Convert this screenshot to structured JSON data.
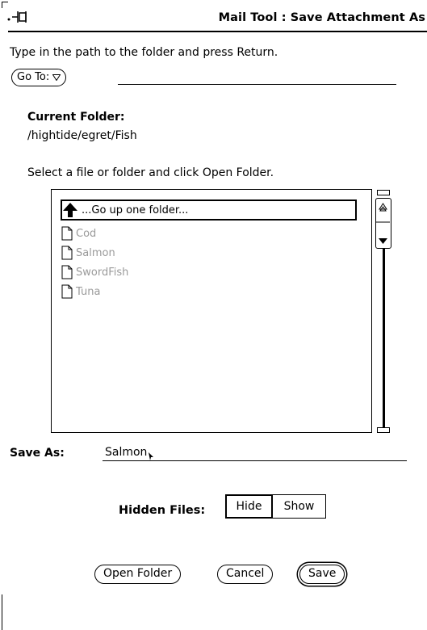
{
  "window": {
    "title": "Mail Tool : Save Attachment As"
  },
  "path_entry": {
    "instruction": "Type in the path to the folder and press Return.",
    "goto_label": "Go To:",
    "goto_icon": "triangle-down-icon",
    "value": ""
  },
  "current_folder": {
    "label": "Current Folder:",
    "path": "/hightide/egret/Fish"
  },
  "file_list": {
    "instruction": "Select a file or folder and click Open Folder.",
    "up_item": {
      "label": "...Go up one folder...",
      "icon": "arrow-up-icon"
    },
    "items": [
      {
        "label": "Cod",
        "icon": "document-icon"
      },
      {
        "label": "Salmon",
        "icon": "document-icon"
      },
      {
        "label": "SwordFish",
        "icon": "document-icon"
      },
      {
        "label": "Tuna",
        "icon": "document-icon"
      }
    ]
  },
  "save_as": {
    "label": "Save As:",
    "value": "Salmon"
  },
  "hidden_files": {
    "label": "Hidden Files:",
    "options": [
      "Hide",
      "Show"
    ],
    "selected": "Hide"
  },
  "buttons": {
    "open_folder": "Open Folder",
    "cancel": "Cancel",
    "save": "Save"
  }
}
